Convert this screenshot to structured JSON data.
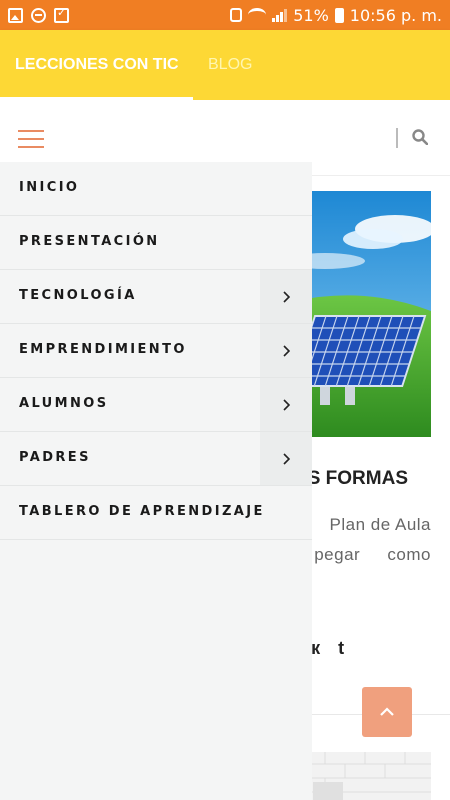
{
  "status_bar": {
    "battery": "51%",
    "time": "10:56 p. m."
  },
  "top_nav": {
    "tabs": [
      "LECCIONES CON TIC",
      "BLOG"
    ]
  },
  "menu": {
    "items": [
      {
        "label": "INICIO",
        "has_submenu": false
      },
      {
        "label": "PRESENTACIÓN",
        "has_submenu": false
      },
      {
        "label": "TECNOLOGÍA",
        "has_submenu": true
      },
      {
        "label": "EMPRENDIMIENTO",
        "has_submenu": true
      },
      {
        "label": "ALUMNOS",
        "has_submenu": true
      },
      {
        "label": "PADRES",
        "has_submenu": true
      },
      {
        "label": "TABLERO DE APRENDIZAJE",
        "has_submenu": false
      }
    ]
  },
  "article": {
    "title_fragment": "S FORMAS",
    "excerpt_line1": "Plan de Aula",
    "excerpt_line2": "pegar   como"
  },
  "social": {
    "icons": [
      "vk-icon",
      "tumblr-icon"
    ],
    "glyphs": [
      "вк",
      "t"
    ]
  },
  "colors": {
    "status_bar": "#f07e23",
    "nav_bar": "#fdd835",
    "accent": "#e98b62",
    "back_to_top": "#f0a07e",
    "drawer_bg": "#f4f5f5"
  }
}
